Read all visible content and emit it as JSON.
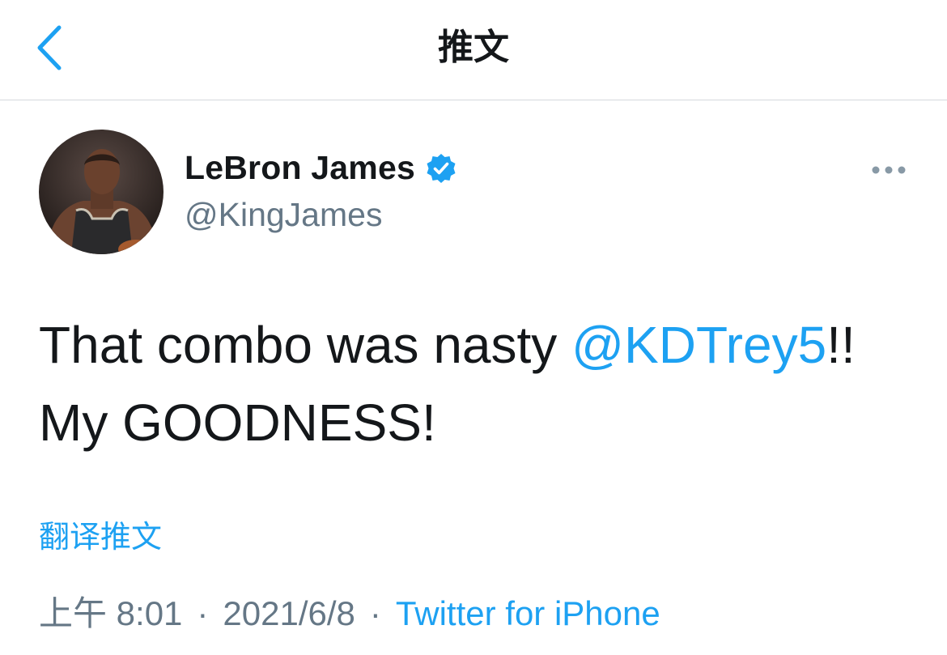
{
  "nav": {
    "title": "推文",
    "back_icon": "chevron-left-icon"
  },
  "author": {
    "display_name": "LeBron James",
    "handle": "@KingJames",
    "verified": true,
    "avatar_description": "avatar"
  },
  "tweet": {
    "text_before": "That combo was nasty ",
    "mention": "@KDTrey5",
    "text_after": "!!",
    "line2": "My GOODNESS!"
  },
  "translate_label": "翻译推文",
  "meta": {
    "time": "上午 8:01",
    "separator": "·",
    "date": "2021/6/8",
    "source": "Twitter for iPhone"
  },
  "colors": {
    "accent": "#1da1f2",
    "secondary_text": "#657786",
    "primary_text": "#14171a",
    "divider": "#d5d9dc"
  }
}
